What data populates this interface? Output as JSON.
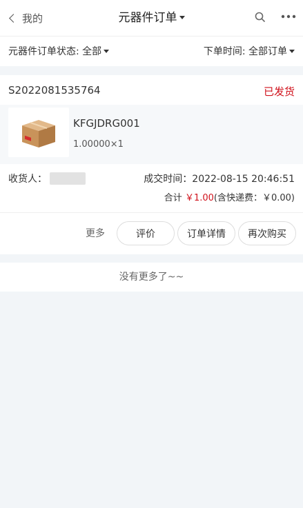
{
  "nav": {
    "back_label": "我的",
    "title": "元器件订单"
  },
  "filter": {
    "status_label": "元器件订单状态: 全部",
    "time_label": "下单时间: 全部订单"
  },
  "order": {
    "order_no": "S2022081535764",
    "status": "已发货",
    "product": {
      "name": "KFGJDRG001",
      "qty_text": "1.00000×1"
    },
    "receiver_label": "收货人：",
    "deal_time_label": "成交时间：",
    "deal_time": "2022-08-15 20:46:51",
    "total_label": "合计",
    "total_amount": "￥1.00",
    "shipping_note": "(含快递费：￥0.00)",
    "actions": {
      "more": "更多",
      "review": "评价",
      "detail": "订单详情",
      "rebuy": "再次购买"
    }
  },
  "footer": {
    "no_more": "没有更多了~~"
  },
  "colors": {
    "accent_red": "#d0111b",
    "page_bg": "#f2f5f8"
  }
}
